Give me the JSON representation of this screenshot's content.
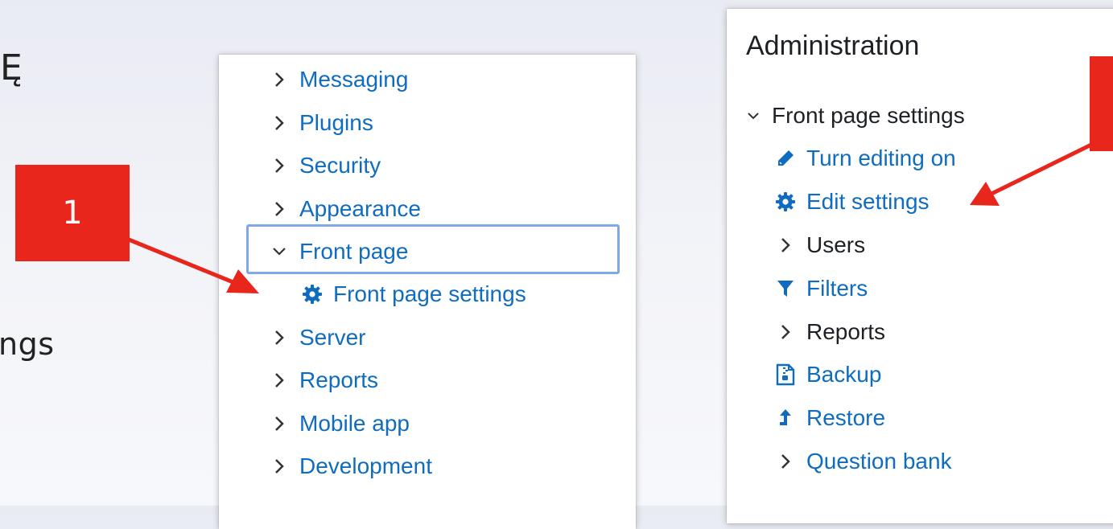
{
  "background": {
    "fragment_text": "Ę",
    "settings_fragment": "ngs"
  },
  "left_menu": {
    "items": [
      {
        "label": "Messaging",
        "state": "collapsed"
      },
      {
        "label": "Plugins",
        "state": "collapsed"
      },
      {
        "label": "Security",
        "state": "collapsed"
      },
      {
        "label": "Appearance",
        "state": "collapsed"
      },
      {
        "label": "Front page",
        "state": "expanded",
        "focused": true
      },
      {
        "label": "Front page settings",
        "icon": "gear-icon",
        "child": true
      },
      {
        "label": "Server",
        "state": "collapsed"
      },
      {
        "label": "Reports",
        "state": "collapsed"
      },
      {
        "label": "Mobile app",
        "state": "collapsed"
      },
      {
        "label": "Development",
        "state": "collapsed"
      }
    ]
  },
  "admin_panel": {
    "title": "Administration",
    "section": {
      "label": "Front page settings",
      "state": "expanded"
    },
    "items": [
      {
        "label": "Turn editing on",
        "icon": "pencil-icon"
      },
      {
        "label": "Edit settings",
        "icon": "gear-icon"
      },
      {
        "label": "Users",
        "icon": "chevron-right-icon"
      },
      {
        "label": "Filters",
        "icon": "filter-icon"
      },
      {
        "label": "Reports",
        "icon": "chevron-right-icon"
      },
      {
        "label": "Backup",
        "icon": "backup-icon"
      },
      {
        "label": "Restore",
        "icon": "upload-icon"
      },
      {
        "label": "Question bank",
        "icon": "chevron-right-icon"
      }
    ]
  },
  "callouts": [
    {
      "label": "1"
    },
    {
      "label": ""
    }
  ],
  "colors": {
    "link": "#0f6cbf",
    "callout": "#e8261c",
    "focus": "#80a8e8"
  }
}
